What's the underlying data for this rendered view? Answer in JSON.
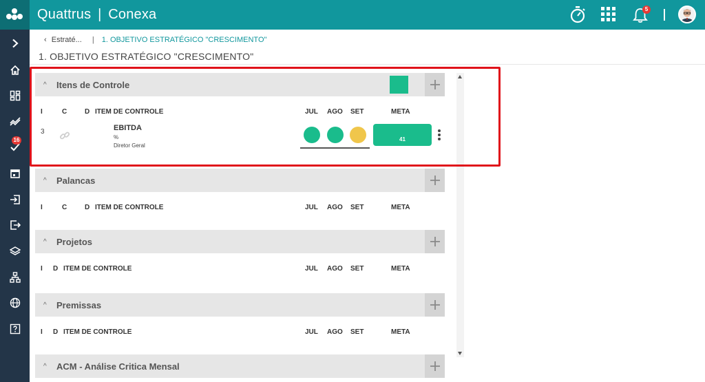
{
  "app": {
    "brand_name": "Quattrus",
    "brand_sep": "|",
    "brand_product": "Conexa",
    "notification_count": "5"
  },
  "sidebar": {
    "items": [
      {
        "icon": "chevron-right-icon"
      },
      {
        "icon": "home-icon"
      },
      {
        "icon": "dashboard-icon"
      },
      {
        "icon": "trend-icon"
      },
      {
        "icon": "tasks-icon",
        "badge": "16"
      },
      {
        "icon": "calendar-icon"
      },
      {
        "icon": "login-icon"
      },
      {
        "icon": "logout-icon"
      },
      {
        "icon": "layers-icon"
      },
      {
        "icon": "hierarchy-icon"
      },
      {
        "icon": "globe-icon"
      },
      {
        "icon": "help-icon"
      }
    ]
  },
  "breadcrumb": {
    "back_label": "Estraté...",
    "separator": "|",
    "current": "1. OBJETIVO ESTRATÉGICO \"CRESCIMENTO\""
  },
  "page": {
    "title": "1. OBJETIVO ESTRATÉGICO \"CRESCIMENTO\""
  },
  "sections": [
    {
      "title": "Itens de Controle",
      "columns": {
        "i": "I",
        "c": "C",
        "d": "D",
        "item": "ITEM DE CONTROLE",
        "m1": "JUL",
        "m2": "AGO",
        "m3": "SET",
        "meta": "META"
      },
      "rows": [
        {
          "num": "3",
          "name": "EBITDA",
          "unit": "%",
          "owner": "Diretor Geral",
          "status": [
            "#1abc8c",
            "#1abc8c",
            "#f0c64b"
          ],
          "meta_value": "41"
        }
      ]
    },
    {
      "title": "Palancas",
      "columns": {
        "i": "I",
        "c": "C",
        "d": "D",
        "item": "ITEM DE CONTROLE",
        "m1": "JUL",
        "m2": "AGO",
        "m3": "SET",
        "meta": "META"
      }
    },
    {
      "title": "Projetos",
      "columns": {
        "i": "I",
        "d": "D",
        "item": "ITEM DE CONTROLE",
        "m1": "JUL",
        "m2": "AGO",
        "m3": "SET",
        "meta": "META"
      }
    },
    {
      "title": "Premissas",
      "columns": {
        "i": "I",
        "d": "D",
        "item": "ITEM DE CONTROLE",
        "m1": "JUL",
        "m2": "AGO",
        "m3": "SET",
        "meta": "META"
      }
    },
    {
      "title": "ACM - Análise Critica Mensal"
    }
  ],
  "colors": {
    "topbar": "#11979d",
    "sidebar": "#233548",
    "status_green": "#1abc8c",
    "status_yellow": "#f0c64b",
    "highlight": "#e0121a"
  }
}
